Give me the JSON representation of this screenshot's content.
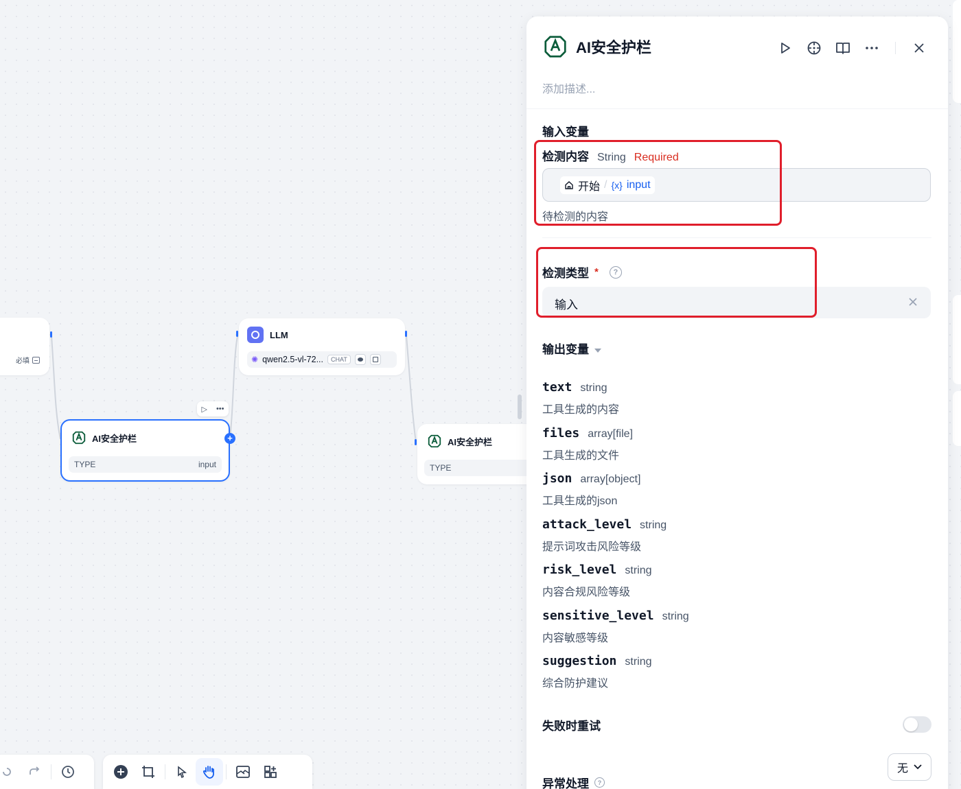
{
  "canvas": {
    "left_node": {
      "required_label": "必填"
    },
    "llm_node": {
      "title": "LLM",
      "model": "qwen2.5-vl-72...",
      "mode_tag": "CHAT"
    },
    "selected_node": {
      "title": "AI安全护栏",
      "type_label": "TYPE",
      "type_value": "input"
    },
    "right_node": {
      "title": "AI安全护栏",
      "type_label": "TYPE"
    },
    "toolbar": {
      "left": [
        "undo-icon",
        "redo-icon",
        "history-icon"
      ],
      "main": [
        "add-node-icon",
        "add-note-icon",
        "pointer-icon",
        "hand-icon",
        "export-image-icon",
        "organize-icon"
      ],
      "active": "hand-icon"
    }
  },
  "panel": {
    "title": "AI安全护栏",
    "description_placeholder": "添加描述...",
    "actions": [
      "run-icon",
      "target-icon",
      "docs-icon",
      "more-icon",
      "close-icon"
    ],
    "input_section_title": "输入变量",
    "detect_content": {
      "label": "检测内容",
      "type": "String",
      "required": "Required",
      "source_node": "开始",
      "separator": "/",
      "variable_marker": "{x}",
      "variable": "input",
      "hint": "待检测的内容"
    },
    "detect_type": {
      "label": "检测类型",
      "required_mark": "*",
      "help": "?",
      "value": "输入"
    },
    "output_section_title": "输出变量",
    "outputs": [
      {
        "name": "text",
        "type": "string",
        "desc": "工具生成的内容"
      },
      {
        "name": "files",
        "type": "array[file]",
        "desc": "工具生成的文件"
      },
      {
        "name": "json",
        "type": "array[object]",
        "desc": "工具生成的json"
      },
      {
        "name": "attack_level",
        "type": "string",
        "desc": "提示词攻击风险等级"
      },
      {
        "name": "risk_level",
        "type": "string",
        "desc": "内容合规风险等级"
      },
      {
        "name": "sensitive_level",
        "type": "string",
        "desc": "内容敏感等级"
      },
      {
        "name": "suggestion",
        "type": "string",
        "desc": "综合防护建议"
      }
    ],
    "retry_on_fail": {
      "label": "失败时重试",
      "enabled": false
    },
    "error_handling": {
      "label": "异常处理",
      "help": "?",
      "value": "无"
    }
  },
  "colors": {
    "accent": "#2970ff",
    "annotation": "#e01e2b",
    "required": "#d92d20",
    "brand_guard": "#0b5c3a"
  }
}
